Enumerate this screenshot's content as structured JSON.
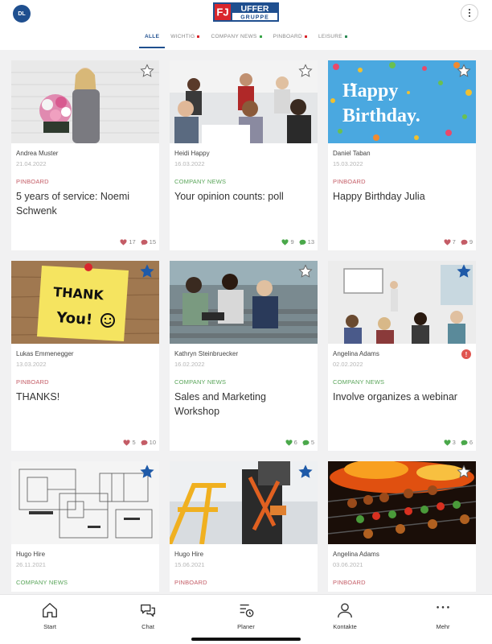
{
  "header": {
    "avatar_initials": "DL",
    "logo_text_top": "UFFER",
    "logo_text_bottom": "GRUPPE",
    "logo_mark": "FJ",
    "brand_color": "#1f4f8f",
    "logo_red": "#d9262c"
  },
  "tabs": [
    {
      "label": "ALLE",
      "active": true,
      "dot_color": ""
    },
    {
      "label": "WICHTIG",
      "active": false,
      "dot_color": "#d9262c"
    },
    {
      "label": "COMPANY NEWS",
      "active": false,
      "dot_color": "#3aa64a"
    },
    {
      "label": "PINBOARD",
      "active": false,
      "dot_color": "#d9262c"
    },
    {
      "label": "LEISURE",
      "active": false,
      "dot_color": "#2e8b57"
    }
  ],
  "colors": {
    "pinboard": "#c45c66",
    "company_news": "#5aa55a",
    "star_active": "#1f5aa8",
    "like_red": "#c45c66",
    "like_green": "#4aa84a"
  },
  "cards": [
    {
      "author": "Andrea Muster",
      "date": "21.04.2022",
      "category": "PINBOARD",
      "title": "5 years of service: Noemi Schwenk",
      "likes": "17",
      "comments": "15",
      "starred": false,
      "image": "woman-with-flowers-photo"
    },
    {
      "author": "Heidi Happy",
      "date": "16.03.2022",
      "category": "COMPANY NEWS",
      "title": "Your opinion counts: poll",
      "likes": "9",
      "comments": "13",
      "starred": false,
      "image": "team-meeting-photo"
    },
    {
      "author": "Daniel Taban",
      "date": "15.03.2022",
      "category": "PINBOARD",
      "title": "Happy Birthday Julia",
      "likes": "7",
      "comments": "9",
      "starred": false,
      "image": "happy-birthday-confetti-image",
      "image_text": "Happy Birthday."
    },
    {
      "author": "Lukas Emmenegger",
      "date": "13.03.2022",
      "category": "PINBOARD",
      "title": "THANKS!",
      "likes": "5",
      "comments": "10",
      "starred": true,
      "image": "thank-you-sticky-note-image",
      "image_text": "THANK You!"
    },
    {
      "author": "Kathryn Steinbruecker",
      "date": "16.02.2022",
      "category": "COMPANY NEWS",
      "title": "Sales and Marketing Workshop",
      "likes": "6",
      "comments": "5",
      "starred": false,
      "image": "students-outdoors-photo"
    },
    {
      "author": "Angelina Adams",
      "date": "02.02.2022",
      "category": "COMPANY NEWS",
      "title": "Involve organizes a webinar",
      "likes": "3",
      "comments": "6",
      "starred": true,
      "image": "presentation-room-photo",
      "alert": "!"
    },
    {
      "author": "Hugo Hire",
      "date": "26.11.2021",
      "category": "COMPANY NEWS",
      "title": "",
      "likes": "",
      "comments": "",
      "starred": true,
      "image": "architectural-plans-image"
    },
    {
      "author": "Hugo Hire",
      "date": "15.06.2021",
      "category": "PINBOARD",
      "title": "",
      "likes": "",
      "comments": "",
      "starred": true,
      "image": "safety-harness-worker-photo"
    },
    {
      "author": "Angelina Adams",
      "date": "03.06.2021",
      "category": "PINBOARD",
      "title": "",
      "likes": "",
      "comments": "",
      "starred": false,
      "image": "bbq-grill-skewers-photo"
    }
  ],
  "bottom_nav": [
    {
      "label": "Start",
      "icon": "home-icon"
    },
    {
      "label": "Chat",
      "icon": "chat-icon"
    },
    {
      "label": "Planer",
      "icon": "planner-icon"
    },
    {
      "label": "Kontakte",
      "icon": "contacts-icon"
    },
    {
      "label": "Mehr",
      "icon": "more-dots-icon"
    }
  ]
}
